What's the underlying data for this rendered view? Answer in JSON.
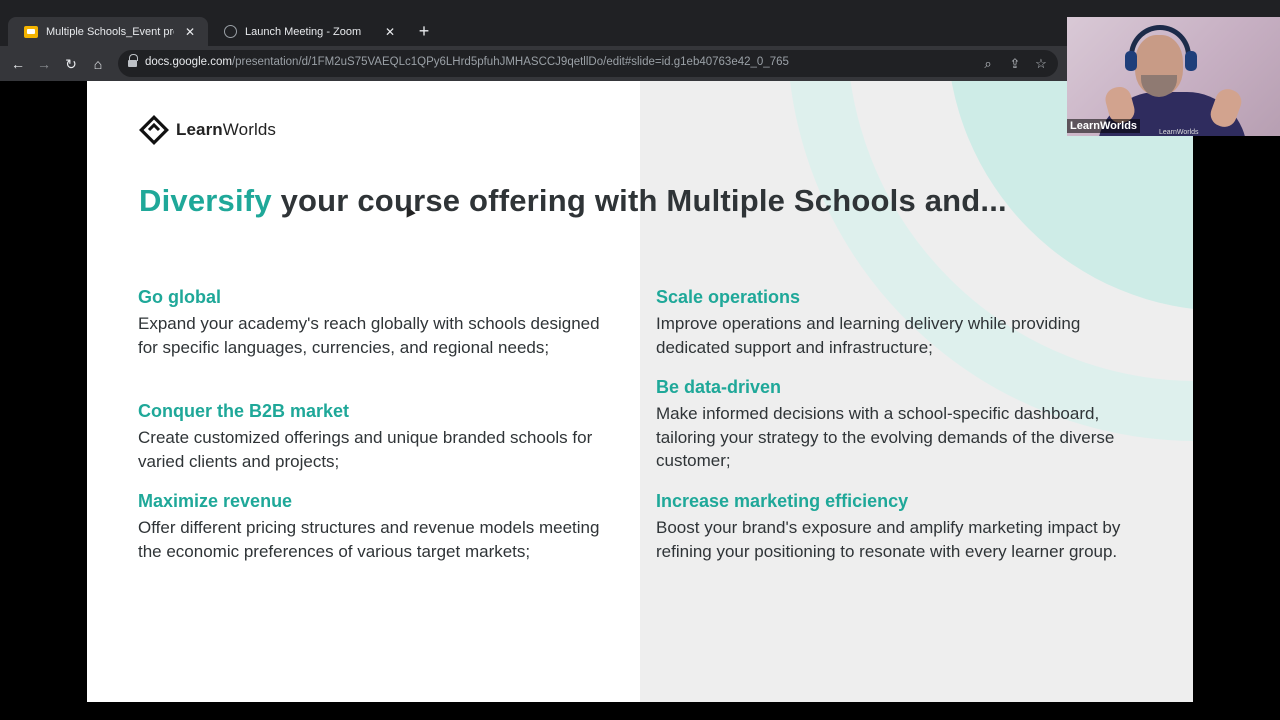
{
  "browser": {
    "tabs": [
      {
        "label": "Multiple Schools_Event presentat",
        "active": true,
        "favicon": "slides-icon"
      },
      {
        "label": "Launch Meeting - Zoom",
        "active": false,
        "favicon": "globe-icon"
      }
    ],
    "new_tab_glyph": "+",
    "close_glyph": "✕",
    "nav": {
      "back": "←",
      "forward": "→",
      "reload": "↻",
      "home": "⌂"
    },
    "url_host": "docs.google.com",
    "url_path": "/presentation/d/1FM2uS75VAEQLc1QPy6LHrd5pfuhJMHASCCJ9qetllDo/edit#slide=id.g1eb40763e42_0_765",
    "omnibox_icons": {
      "zoom": "⌕",
      "share": "⇪",
      "bookmark": "☆"
    }
  },
  "slide": {
    "logo": {
      "bold": "Learn",
      "regular": "Worlds"
    },
    "headline": {
      "accent": "Diversify",
      "rest": " your course offering with Multiple Schools and..."
    },
    "items": [
      {
        "title": "Go global",
        "text": "Expand your academy's reach globally with schools designed for specific languages, currencies, and regional needs;"
      },
      {
        "title": "Conquer the B2B market",
        "text": "Create customized offerings and unique branded schools for varied clients and projects;"
      },
      {
        "title": "Maximize revenue",
        "text": "Offer different pricing structures and revenue models meeting the economic preferences of various target markets;"
      },
      {
        "title": "Scale operations",
        "text": "Improve operations and learning delivery while providing dedicated support and infrastructure;"
      },
      {
        "title": "Be data-driven",
        "text": "Make informed decisions with a school-specific dashboard, tailoring your strategy to the evolving demands of the diverse customer;"
      },
      {
        "title": "Increase marketing efficiency",
        "text": "Boost your brand's exposure and amplify marketing impact by refining your positioning to resonate with every learner group."
      }
    ],
    "colors": {
      "accent": "#1fa899",
      "text": "#2f3437",
      "right_panel": "#eeeeee"
    }
  },
  "video": {
    "participant_name": "LearnWorlds",
    "shirt_text": "LearnWorlds"
  }
}
